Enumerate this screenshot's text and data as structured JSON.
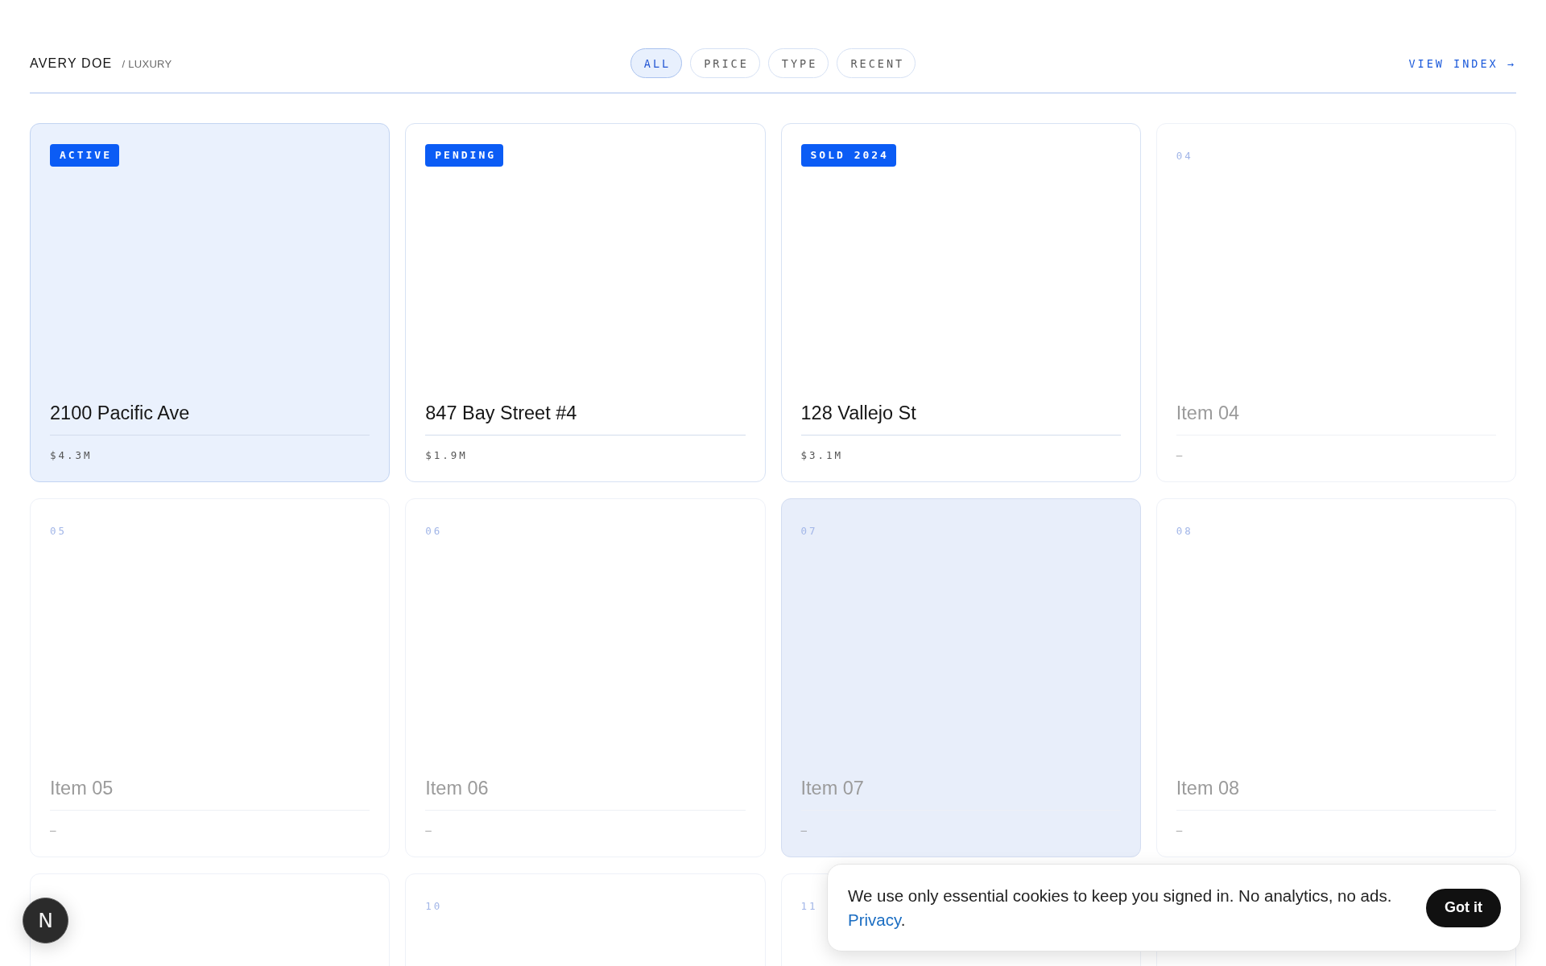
{
  "header": {
    "brand": "AVERY DOE",
    "section": "/ LUXURY",
    "filters": [
      {
        "label": "ALL",
        "selected": true
      },
      {
        "label": "PRICE",
        "selected": false
      },
      {
        "label": "TYPE",
        "selected": false
      },
      {
        "label": "RECENT",
        "selected": false
      }
    ],
    "index_link": "VIEW INDEX →"
  },
  "listings": [
    {
      "kind": "listing",
      "badge": "ACTIVE",
      "title": "2100 Pacific Ave",
      "price": "$4.3M",
      "selected": true,
      "hovered": false
    },
    {
      "kind": "listing",
      "badge": "PENDING",
      "title": "847 Bay Street #4",
      "price": "$1.9M",
      "selected": false,
      "hovered": false
    },
    {
      "kind": "listing",
      "badge": "SOLD 2024",
      "title": "128 Vallejo St",
      "price": "$3.1M",
      "selected": false,
      "hovered": false
    },
    {
      "kind": "placeholder",
      "number": "04",
      "title": "Item 04",
      "price": "–",
      "selected": false,
      "hovered": false
    },
    {
      "kind": "placeholder",
      "number": "05",
      "title": "Item 05",
      "price": "–",
      "selected": false,
      "hovered": false
    },
    {
      "kind": "placeholder",
      "number": "06",
      "title": "Item 06",
      "price": "–",
      "selected": false,
      "hovered": false
    },
    {
      "kind": "placeholder",
      "number": "07",
      "title": "Item 07",
      "price": "–",
      "selected": false,
      "hovered": true
    },
    {
      "kind": "placeholder",
      "number": "08",
      "title": "Item 08",
      "price": "–",
      "selected": false,
      "hovered": false
    },
    {
      "kind": "placeholder",
      "selected": false,
      "hovered": false
    },
    {
      "kind": "placeholder",
      "number": "10",
      "selected": false,
      "hovered": false
    },
    {
      "kind": "placeholder",
      "number": "11",
      "selected": false,
      "hovered": false
    },
    {
      "kind": "placeholder",
      "selected": false,
      "hovered": false
    }
  ],
  "cookie_banner": {
    "message": "We use only essential cookies to keep you signed in. No analytics, no ads.",
    "link": "Privacy",
    "link_suffix": ".",
    "button": "Got it"
  },
  "floating_badge": {
    "label": "N"
  }
}
